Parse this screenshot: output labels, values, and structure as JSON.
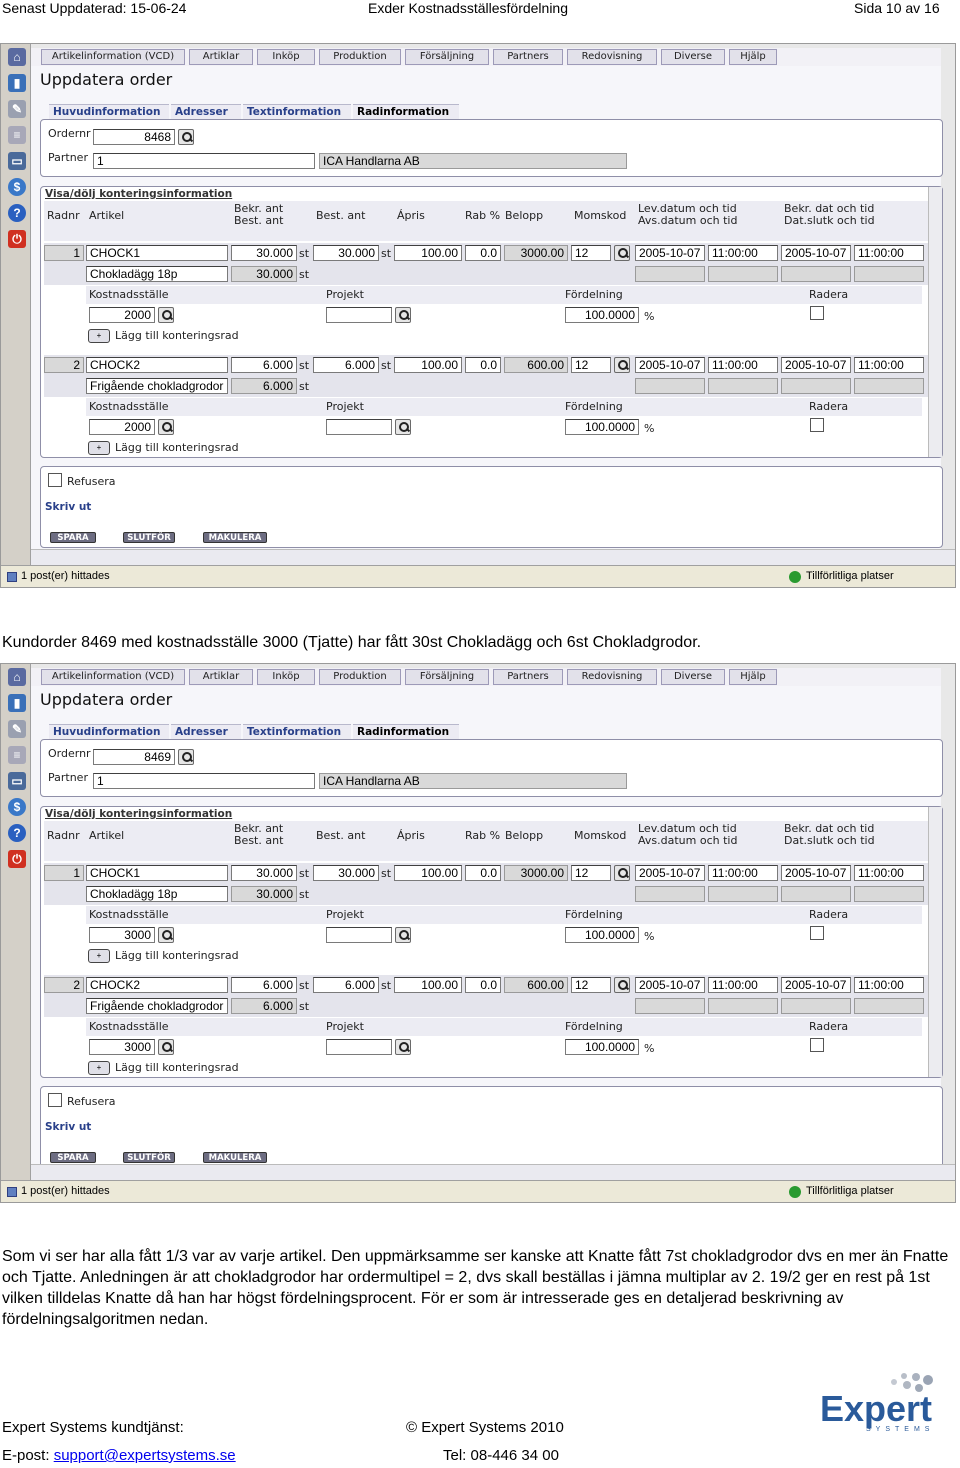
{
  "header": {
    "left": "Senast Uppdaterad: 15-06-24",
    "center": "Exder Kostnadsställesfördelning",
    "right": "Sida 10 av 16"
  },
  "caption1": "Kundorder 8469 med kostnadsställe 3000 (Tjatte) har fått 30st Chokladägg och 6st Chokladgrodor.",
  "body_text": "Som vi ser har alla fått 1/3 var av varje artikel. Den uppmärksamme ser kanske att Knatte fått 7st chokladgrodor dvs en mer än Fnatte och Tjatte. Anledningen är att chokladgrodor har ordermultipel = 2, dvs skall beställas i jämna multiplar av 2. 19/2 ger en rest på 1st vilken tilldelas Knatte då han har högst fördelningsprocent. För er som är intresserade ges en detaljerad beskrivning av fördelningsalgoritmen nedan.",
  "ui": {
    "menu": [
      "Artikelinformation (VCD)",
      "Artiklar",
      "Inköp",
      "Produktion",
      "Försäljning",
      "Partners",
      "Redovisning",
      "Diverse",
      "Hjälp"
    ],
    "page_title": "Uppdatera order",
    "subtabs": [
      "Huvudinformation",
      "Adresser",
      "Textinformation",
      "Radinformation"
    ],
    "ordernr_label": "Ordernr",
    "partner_label": "Partner",
    "partner_no": "1",
    "partner_name": "ICA Handlarna AB",
    "toggle_link": "Visa/dölj konteringsinformation",
    "cols": {
      "radnr": "Radnr",
      "artikel": "Artikel",
      "bekr_ant": "Bekr. ant",
      "best_ant": "Best. ant",
      "apris": "Ápris",
      "rab": "Rab %",
      "belopp": "Belopp",
      "momskod": "Momskod",
      "lev_datum": "Lev.datum och tid",
      "avs_datum": "Avs.datum och tid",
      "bekr_dat": "Bekr. dat och tid",
      "dat_slut": "Dat.slutk och tid"
    },
    "sub_cols": {
      "kostnadsstalle": "Kostnadsställe",
      "projekt": "Projekt",
      "fordelning": "Fördelning",
      "radera": "Radera"
    },
    "add_row": "Lägg till konteringsrad",
    "unit": "st",
    "percent": "%",
    "refusera": "Refusera",
    "skriv_ut": "Skriv ut",
    "buttons": [
      "SPARA",
      "SLUTFÖR",
      "MAKULERA"
    ],
    "status_left": "1 post(er) hittades",
    "status_right": "Tillförlitliga platser",
    "lines": [
      {
        "radnr": "1",
        "artikel": "CHOCK1",
        "desc": "Chokladägg 18p",
        "bekr_ant": "30.000",
        "best_ant": "30.000",
        "bekr_ant2": "30.000",
        "apris": "100.00",
        "rab": "0.0",
        "belopp": "3000.00",
        "momskod": "12",
        "lev_date": "2005-10-07",
        "lev_time": "11:00:00",
        "bekr_date": "2005-10-07",
        "bekr_time": "11:00:00",
        "fordelning": "100.0000"
      },
      {
        "radnr": "2",
        "artikel": "CHOCK2",
        "desc": "Frigående chokladgrodor",
        "bekr_ant": "6.000",
        "best_ant": "6.000",
        "bekr_ant2": "6.000",
        "apris": "100.00",
        "rab": "0.0",
        "belopp": "600.00",
        "momskod": "12",
        "lev_date": "2005-10-07",
        "lev_time": "11:00:00",
        "bekr_date": "2005-10-07",
        "bekr_time": "11:00:00",
        "fordelning": "100.0000"
      }
    ]
  },
  "screens": [
    {
      "ordernr": "8468",
      "kostnadsstalle": "2000"
    },
    {
      "ordernr": "8469",
      "kostnadsstalle": "3000"
    }
  ],
  "footer": {
    "support_label": "Expert Systems kundtjänst:",
    "copyright": "© Expert Systems 2010",
    "email_label": "E-post: ",
    "email": "support@expertsystems.se",
    "tel": "Tel: 08-446 34 00",
    "logo_word": "Expert",
    "logo_sub": "SYSTEMS"
  }
}
